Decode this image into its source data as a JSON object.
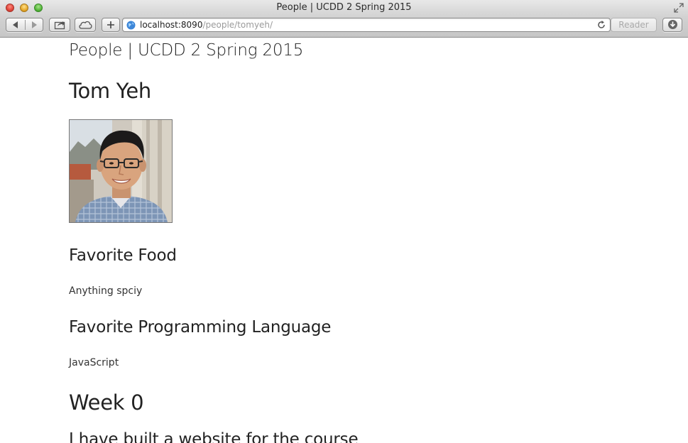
{
  "window": {
    "title": "People | UCDD 2 Spring 2015"
  },
  "toolbar": {
    "url_host": "localhost:8090",
    "url_path": "/people/tomyeh/",
    "reader_label": "Reader"
  },
  "page": {
    "site_title": "People | UCDD 2 Spring 2015",
    "person_name": "Tom Yeh",
    "sections": [
      {
        "heading": "Favorite Food",
        "text": "Anything spciy"
      },
      {
        "heading": "Favorite Programming Language",
        "text": "JavaScript"
      }
    ],
    "week_heading": "Week 0",
    "week_text": "I have built a website for the course"
  },
  "icons": {
    "back": "chevron-left-icon",
    "forward": "chevron-right-icon",
    "share": "share-icon",
    "cloud": "cloud-icon",
    "new_tab": "plus-icon",
    "site": "globe-icon",
    "reload": "reload-icon",
    "download": "download-icon",
    "fullscreen": "fullscreen-icon"
  },
  "colors": {
    "chrome_top": "#e8e8e8",
    "chrome_bottom": "#c6c6c6",
    "text": "#222222",
    "url_path": "#9a9a9a"
  }
}
